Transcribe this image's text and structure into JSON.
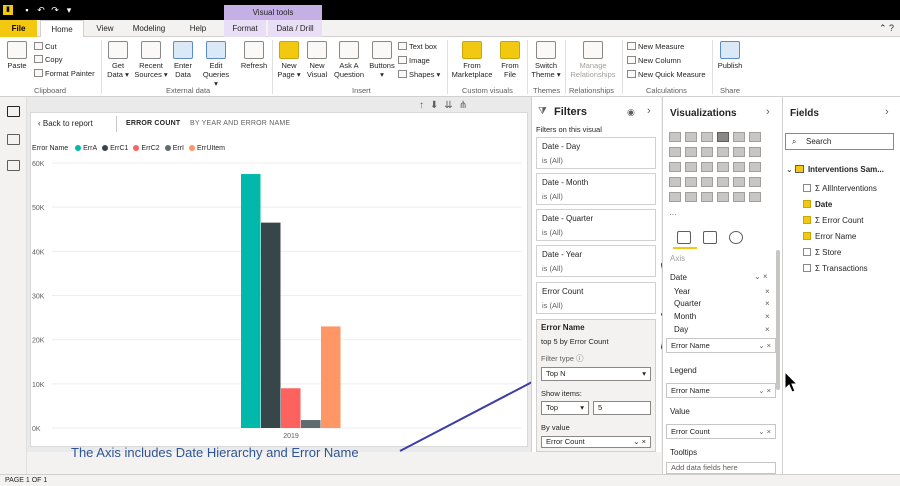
{
  "titlebar": {
    "visual_tools": "Visual tools"
  },
  "tabs": [
    "File",
    "Home",
    "View",
    "Modeling",
    "Help",
    "Format",
    "Data / Drill"
  ],
  "ribbon": {
    "clipboard": {
      "paste": "Paste",
      "cut": "Cut",
      "copy": "Copy",
      "format_painter": "Format Painter",
      "group": "Clipboard"
    },
    "external": {
      "get_data": "Get Data ▾",
      "recent": "Recent Sources ▾",
      "enter": "Enter Data",
      "edit": "Edit Queries ▾",
      "refresh": "Refresh",
      "group": "External data"
    },
    "insert": {
      "new_page": "New Page ▾",
      "new_visual": "New Visual",
      "ask": "Ask A Question",
      "buttons": "Buttons ▾",
      "text_box": "Text box",
      "image": "Image",
      "shapes": "Shapes ▾",
      "group": "Insert"
    },
    "custom": {
      "marketplace": "From Marketplace",
      "file": "From File",
      "group": "Custom visuals"
    },
    "themes": {
      "switch": "Switch Theme ▾",
      "group": "Themes"
    },
    "relationships": {
      "manage": "Manage Relationships",
      "group": "Relationships"
    },
    "calculations": {
      "new_measure": "New Measure",
      "new_column": "New Column",
      "new_quick": "New Quick Measure",
      "group": "Calculations"
    },
    "share": {
      "publish": "Publish",
      "group": "Share"
    }
  },
  "visual": {
    "back": "Back to report",
    "breadcrumb_title": "ERROR COUNT",
    "breadcrumb_by": "BY YEAR AND ERROR NAME",
    "legend_label": "Error Name",
    "caption": "The Axis includes Date Hierarchy and Error Name"
  },
  "chart_data": {
    "type": "bar",
    "categories": [
      "2019"
    ],
    "series": [
      {
        "name": "ErrA",
        "values": [
          57500
        ],
        "color": "#01b8aa"
      },
      {
        "name": "ErrC1",
        "values": [
          46500
        ],
        "color": "#374649"
      },
      {
        "name": "ErrC2",
        "values": [
          9000
        ],
        "color": "#fd625e"
      },
      {
        "name": "ErrI",
        "values": [
          1800
        ],
        "color": "#5f6b6d"
      },
      {
        "name": "ErrUItem",
        "values": [
          23000
        ],
        "color": "#fe9666"
      }
    ],
    "yticks": [
      "0K",
      "10K",
      "20K",
      "30K",
      "40K",
      "50K",
      "60K"
    ],
    "ylim": [
      0,
      60000
    ],
    "xlabel": "",
    "ylabel": ""
  },
  "filters": {
    "title": "Filters",
    "subtitle": "Filters on this visual",
    "cards": [
      {
        "title": "Date - Day",
        "value": "is (All)"
      },
      {
        "title": "Date - Month",
        "value": "is (All)"
      },
      {
        "title": "Date - Quarter",
        "value": "is (All)"
      },
      {
        "title": "Date - Year",
        "value": "is (All)"
      },
      {
        "title": "Error Count",
        "value": "is (All)"
      }
    ],
    "expanded": {
      "title": "Error Name",
      "summary": "top 5 by Error Count",
      "filter_type_label": "Filter type ⓘ",
      "filter_type": "Top N",
      "show_items_label": "Show items:",
      "show_dir": "Top",
      "show_count": "5",
      "by_value_label": "By value",
      "by_value": "Error Count"
    }
  },
  "visualizations": {
    "title": "Visualizations",
    "axis_label": "Axis",
    "axis_field": "Date",
    "hierarchy": [
      "Year",
      "Quarter",
      "Month",
      "Day"
    ],
    "axis_second": "Error Name",
    "legend_label": "Legend",
    "legend_field": "Error Name",
    "value_label": "Value",
    "value_field": "Error Count",
    "tooltips_label": "Tooltips",
    "tooltips_placeholder": "Add data fields here"
  },
  "fields": {
    "title": "Fields",
    "search": "Search",
    "table": "Interventions Sam...",
    "items": [
      {
        "name": "AllInterventions",
        "checked": false
      },
      {
        "name": "Date",
        "checked": true
      },
      {
        "name": "Error Count",
        "checked": true
      },
      {
        "name": "Error Name",
        "checked": true
      },
      {
        "name": "Store",
        "checked": false
      },
      {
        "name": "Transactions",
        "checked": false
      }
    ]
  },
  "status": {
    "page": "PAGE 1 OF 1"
  }
}
